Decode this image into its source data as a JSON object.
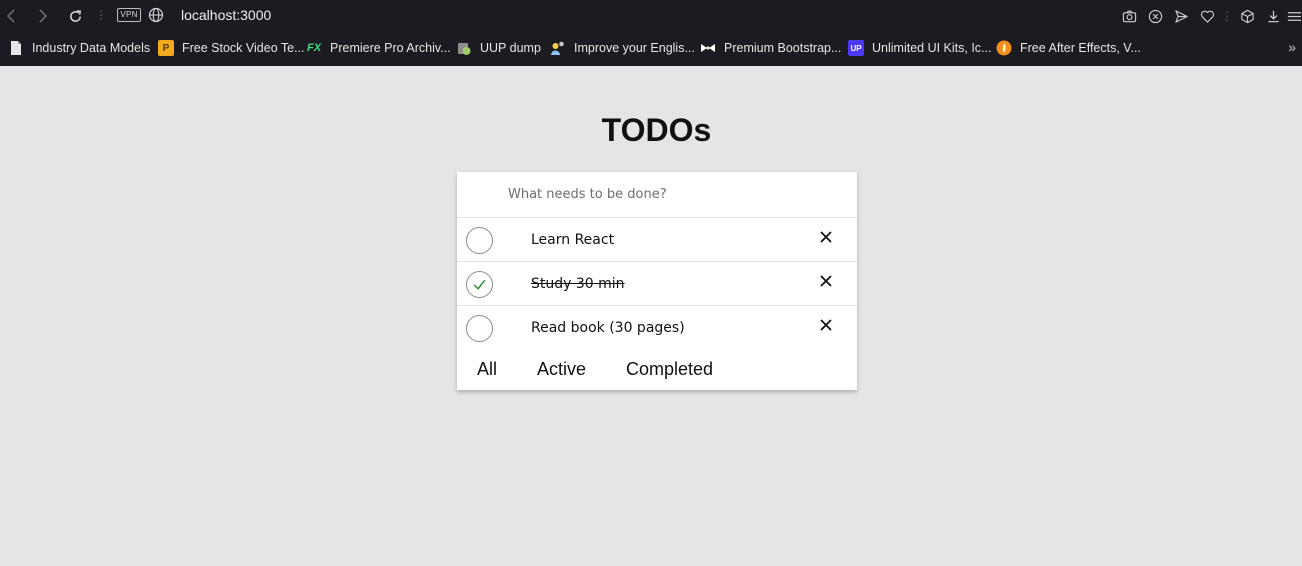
{
  "browser": {
    "url": "localhost:3000",
    "vpn_label": "VPN",
    "bookmarks": [
      {
        "label": "Industry Data Models",
        "icon": "document-icon",
        "color": "#e6e6e6"
      },
      {
        "label": "Free Stock Video Te...",
        "icon": "p-logo-icon",
        "color": "#f2a91b"
      },
      {
        "label": "Premiere Pro Archiv...",
        "icon": "fx-logo-icon",
        "color": "#3ddc84"
      },
      {
        "label": "UUP dump",
        "icon": "uup-logo-icon",
        "color": "#9ccc65"
      },
      {
        "label": "Improve your Englis...",
        "icon": "people-icon",
        "color": "#f6d24b"
      },
      {
        "label": "Premium Bootstrap...",
        "icon": "bow-icon",
        "color": "#ffffff"
      },
      {
        "label": "Unlimited UI Kits, Ic...",
        "icon": "up-logo-icon",
        "color": "#4a3aff"
      },
      {
        "label": "Free After Effects, V...",
        "icon": "flame-icon",
        "color": "#f28c1b"
      }
    ]
  },
  "app": {
    "title": "TODOs",
    "new_todo_placeholder": "What needs to be done?",
    "todos": [
      {
        "text": "Learn React",
        "completed": false
      },
      {
        "text": "Study 30 min",
        "completed": true
      },
      {
        "text": "Read book (30 pages)",
        "completed": false
      }
    ],
    "filters": [
      "All",
      "Active",
      "Completed"
    ]
  },
  "colors": {
    "page_bg": "#e5e5e5",
    "chrome_bg": "#1c1b22",
    "check_mark": "#2e8b3a"
  }
}
